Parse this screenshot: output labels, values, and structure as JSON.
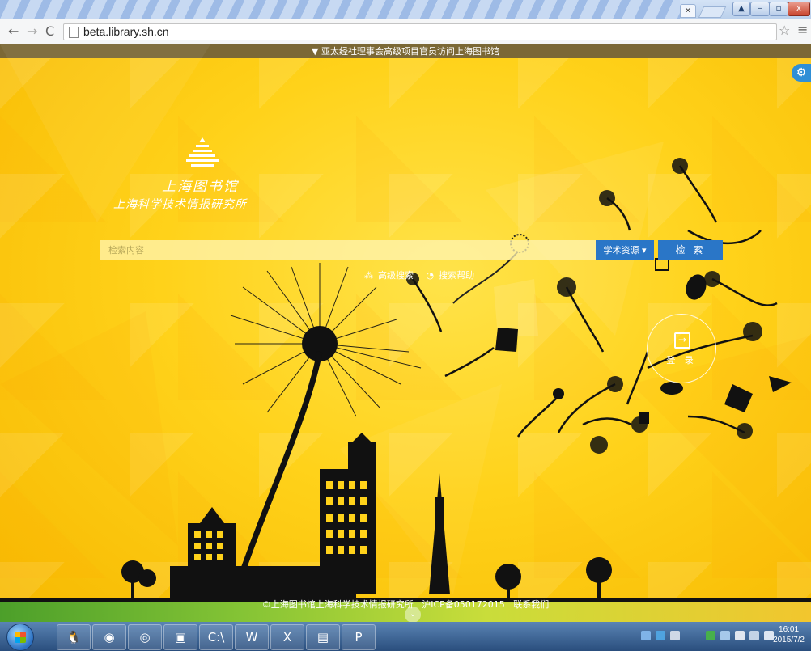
{
  "browser": {
    "url": "beta.library.sh.cn",
    "tab_close": "×",
    "window_controls": {
      "minimize": "–",
      "restore": "▫",
      "close": "x"
    }
  },
  "announcement": "亚太经社理事会高级项目官员访问上海图书馆",
  "logo": {
    "name": "上海图书馆",
    "subtitle": "上海科学技术情报研究所"
  },
  "search": {
    "placeholder": "检索内容",
    "scope_label": "学术资源",
    "button_label": "检 索",
    "advanced_label": "高级搜索",
    "help_label": "搜索帮助"
  },
  "login": {
    "label": "登 录"
  },
  "footer": {
    "copyright": "©上海图书馆上海科学技术情报研究所",
    "icp": "沪ICP备050172015",
    "contact": "联系我们"
  },
  "taskbar": {
    "apps": [
      {
        "name": "qq",
        "glyph": "🐧"
      },
      {
        "name": "firefox",
        "glyph": "◉"
      },
      {
        "name": "chrome",
        "glyph": "◎"
      },
      {
        "name": "explorer-window",
        "glyph": "▣"
      },
      {
        "name": "cmd",
        "glyph": "C:\\"
      },
      {
        "name": "word",
        "glyph": "W"
      },
      {
        "name": "excel",
        "glyph": "X"
      },
      {
        "name": "file-manager",
        "glyph": "▤"
      },
      {
        "name": "powerpoint",
        "glyph": "P"
      }
    ],
    "time": "16:01",
    "date": "2015/7/2"
  },
  "colors": {
    "accent_blue": "#2a76c7",
    "background_yellow": "#ffd21a",
    "announce_bar": "#7b6836"
  }
}
